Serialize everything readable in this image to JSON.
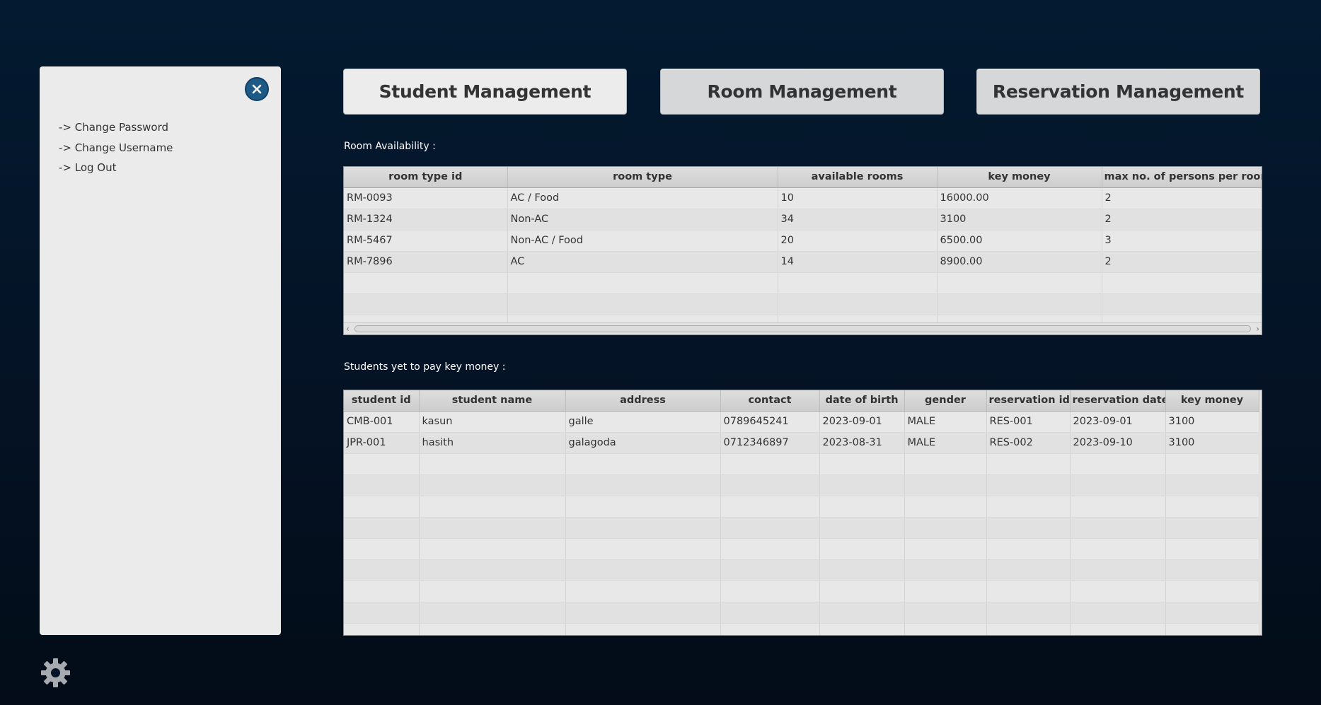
{
  "side_panel": {
    "menu": [
      {
        "label": "-> Change Password"
      },
      {
        "label": "-> Change Username"
      },
      {
        "label": "-> Log Out"
      }
    ]
  },
  "nav": {
    "student": "Student Management",
    "room": "Room Management",
    "reservation": "Reservation Management"
  },
  "room_section": {
    "label": "Room Availability :",
    "columns": [
      "room type id",
      "room type",
      "available rooms",
      "key money",
      "max no. of persons per room"
    ],
    "rows": [
      [
        "RM-0093",
        "AC / Food",
        "10",
        "16000.00",
        "2"
      ],
      [
        "RM-1324",
        "Non-AC",
        "34",
        "3100",
        "2"
      ],
      [
        "RM-5467",
        "Non-AC / Food",
        "20",
        "6500.00",
        "3"
      ],
      [
        "RM-7896",
        "AC",
        "14",
        "8900.00",
        "2"
      ]
    ]
  },
  "student_section": {
    "label": "Students yet to pay key money :",
    "columns": [
      "student id",
      "student name",
      "address",
      "contact",
      "date of birth",
      "gender",
      "reservation id",
      "reservation date",
      "key money"
    ],
    "rows": [
      [
        "CMB-001",
        "kasun",
        "galle",
        "0789645241",
        "2023-09-01",
        "MALE",
        "RES-001",
        "2023-09-01",
        "3100"
      ],
      [
        "JPR-001",
        "hasith",
        "galagoda",
        "0712346897",
        "2023-08-31",
        "MALE",
        "RES-002",
        "2023-09-10",
        "3100"
      ]
    ]
  },
  "icons": {
    "close": "close-icon",
    "settings": "gear-icon"
  },
  "colors": {
    "background": "#041427",
    "panel": "#ebebeb",
    "accent": "#1d5a86"
  }
}
